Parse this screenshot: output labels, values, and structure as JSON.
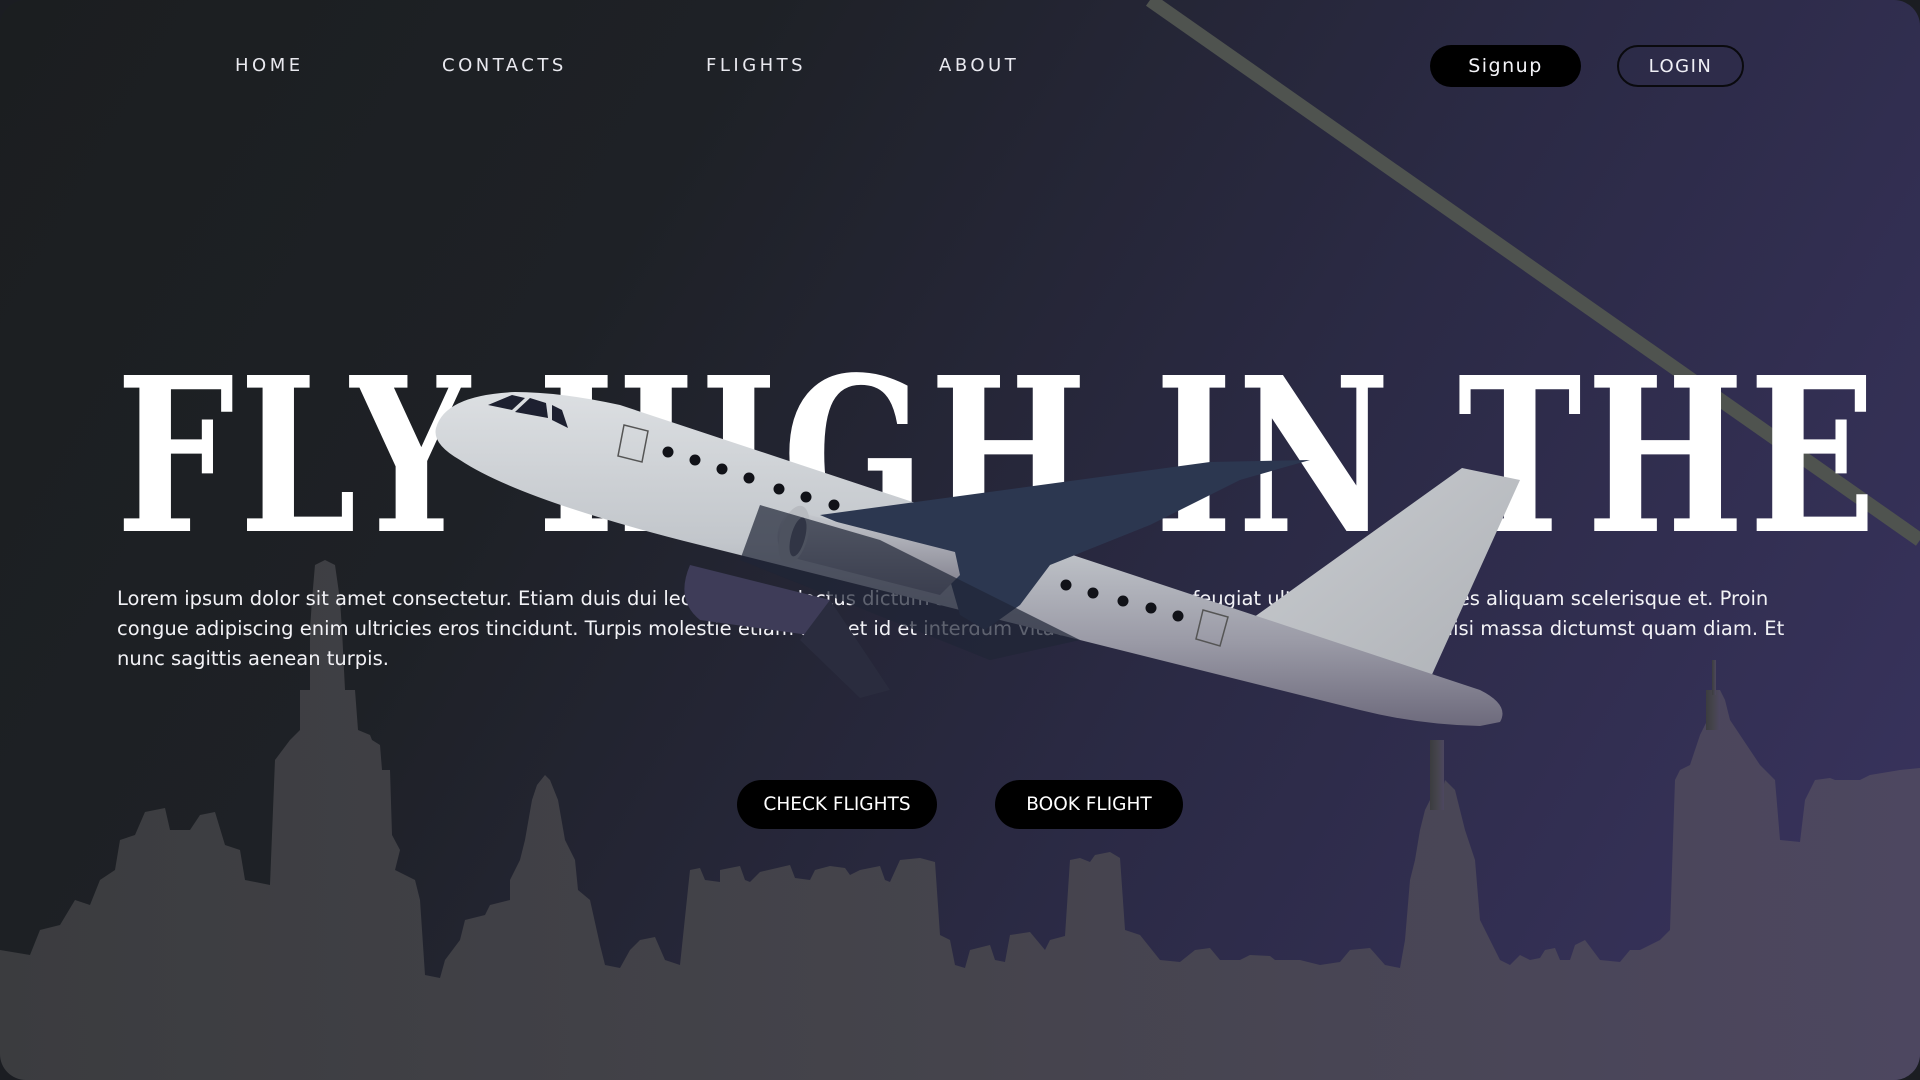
{
  "nav": {
    "links": [
      {
        "label": "HOME"
      },
      {
        "label": "CONTACTS"
      },
      {
        "label": "FLIGHTS"
      },
      {
        "label": "ABOUT"
      }
    ],
    "signup_label": "Signup",
    "login_label": "LOGIN"
  },
  "hero": {
    "title": "FLY HIGH IN THE AIR",
    "body": "Lorem ipsum dolor sit amet consectetur. Etiam duis dui lectus ornare lectus dictum sodales. In dolor pharetra feugiat ultrices morbi ultrices aliquam scelerisque et. Proin congue adipiscing enim ultricies eros tincidunt. Turpis molestie etiam aliquet id et interdum vitae volutpat quis nec quam at. Vel leo facilisi massa dictumst quam diam. Et nunc sagittis aenean turpis.",
    "check_flights_label": "CHECK FLIGHTS",
    "book_flight_label": "BOOK FLIGHT"
  },
  "colors": {
    "background_start": "#1b1e20",
    "background_end": "#3a3460",
    "button_bg": "#000000",
    "text": "#ffffff",
    "skyline": "#4a4a52"
  },
  "icons": {
    "hero_image": "airplane-illustration",
    "background": "city-skyline"
  }
}
